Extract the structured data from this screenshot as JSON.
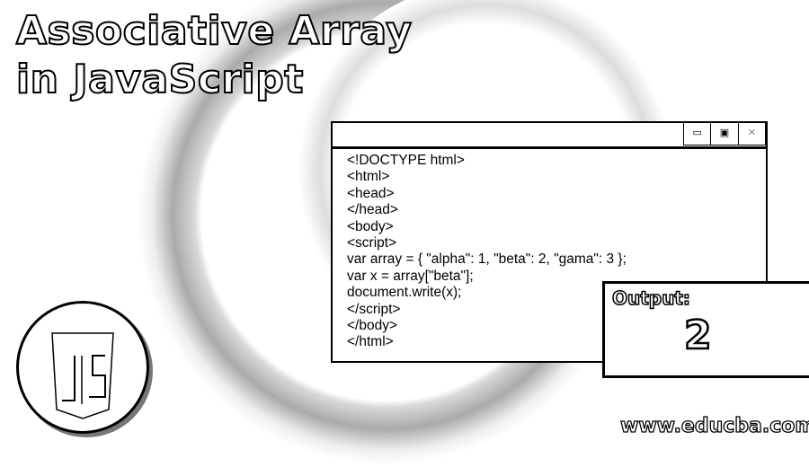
{
  "title": {
    "line1": "Associative Array",
    "line2": "in JavaScript"
  },
  "window": {
    "controls": [
      "minimize-icon",
      "maximize-icon",
      "close-icon"
    ],
    "code_lines": [
      "<!DOCTYPE html>",
      "<html>",
      "<head>",
      "</head>",
      "<body>",
      "<script>",
      "var array = { \"alpha\": 1, \"beta\": 2, \"gama\": 3 };",
      "var x = array[\"beta\"];",
      "document.write(x);",
      "</script>",
      "</body>",
      "</html>"
    ]
  },
  "output": {
    "label": "Output:",
    "value": "2"
  },
  "logo": {
    "text": "JS"
  },
  "footer": {
    "site": "www.educba.com"
  }
}
